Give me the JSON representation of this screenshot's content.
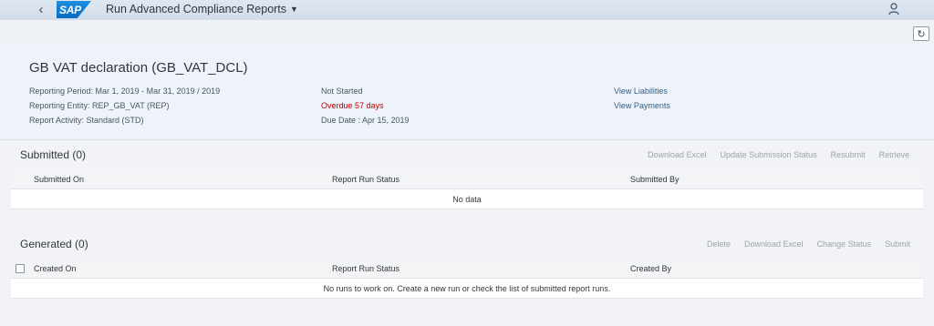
{
  "shell": {
    "logo_text": "SAP",
    "app_title": "Run Advanced Compliance Reports",
    "back_icon": "chevron-left-icon",
    "user_icon": "person-icon",
    "refresh_icon": "refresh-icon"
  },
  "header": {
    "title": "GB VAT declaration (GB_VAT_DCL)",
    "col1": [
      "Reporting Period: Mar 1, 2019 - Mar 31, 2019 / 2019",
      "Reporting Entity: REP_GB_VAT (REP)",
      "Report Activity: Standard (STD)"
    ],
    "col2": {
      "status": "Not Started",
      "overdue": "Overdue 57 days",
      "due_date": "Due Date : Apr 15, 2019"
    },
    "links": {
      "view_liabilities": "View Liabilities",
      "view_payments": "View Payments"
    },
    "overdue_color": "#bb0000"
  },
  "submitted": {
    "title": "Submitted (0)",
    "actions": {
      "download_excel": "Download Excel",
      "update_submission_status": "Update Submission Status",
      "resubmit": "Resubmit",
      "retrieve": "Retrieve"
    },
    "columns": [
      "Submitted On",
      "Report Run Status",
      "Submitted By"
    ],
    "empty_text": "No data"
  },
  "generated": {
    "title": "Generated (0)",
    "actions": {
      "delete": "Delete",
      "download_excel": "Download Excel",
      "change_status": "Change Status",
      "submit": "Submit"
    },
    "columns": [
      "Created On",
      "Report Run Status",
      "Created By"
    ],
    "empty_text": "No runs to work on. Create a new run or check the list of submitted report runs."
  }
}
